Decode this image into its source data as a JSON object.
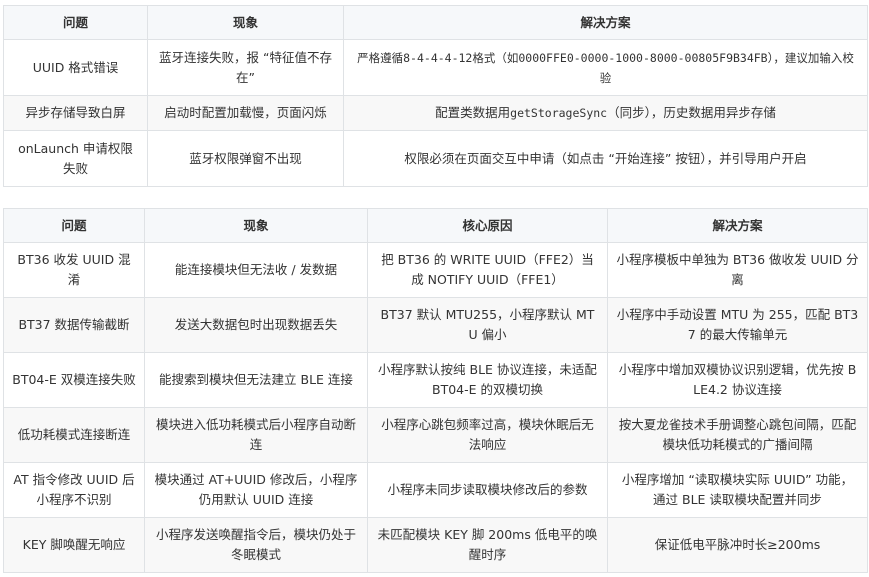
{
  "table1": {
    "headers": [
      "问题",
      "现象",
      "解决方案"
    ],
    "rows": [
      [
        "UUID 格式错误",
        "蓝牙连接失败，报 “特征值不存在”",
        "严格遵循8-4-4-4-12格式（如0000FFE0-0000-1000-8000-00805F9B34FB），建议加输入校验"
      ],
      [
        "异步存储导致白屏",
        "启动时配置加载慢，页面闪烁",
        "配置类数据用getStorageSync（同步），历史数据用异步存储"
      ],
      [
        "onLaunch 申请权限失败",
        "蓝牙权限弹窗不出现",
        "权限必须在页面交互中申请（如点击 “开始连接” 按钮），并引导用户开启"
      ]
    ]
  },
  "table2": {
    "headers": [
      "问题",
      "现象",
      "核心原因",
      "解决方案"
    ],
    "rows": [
      [
        "BT36 收发 UUID 混淆",
        "能连接模块但无法收 / 发数据",
        "把 BT36 的 WRITE UUID（FFE2）当成 NOTIFY UUID（FFE1）",
        "小程序模板中单独为 BT36 做收发 UUID 分离"
      ],
      [
        "BT37 数据传输截断",
        "发送大数据包时出现数据丢失",
        "BT37 默认 MTU255，小程序默认 MTU 偏小",
        "小程序中手动设置 MTU 为 255，匹配 BT37 的最大传输单元"
      ],
      [
        "BT04-E 双模连接失败",
        "能搜索到模块但无法建立 BLE 连接",
        "小程序默认按纯 BLE 协议连接，未适配 BT04-E 的双模切换",
        "小程序中增加双模协议识别逻辑，优先按 BLE4.2 协议连接"
      ],
      [
        "低功耗模式连接断连",
        "模块进入低功耗模式后小程序自动断连",
        "小程序心跳包频率过高，模块休眠后无法响应",
        "按大夏龙雀技术手册调整心跳包间隔，匹配模块低功耗模式的广播间隔"
      ],
      [
        "AT 指令修改 UUID 后小程序不识别",
        "模块通过 AT+UUID 修改后，小程序仍用默认 UUID 连接",
        "小程序未同步读取模块修改后的参数",
        "小程序增加 “读取模块实际 UUID” 功能，通过 BLE 读取模块配置并同步"
      ],
      [
        "KEY 脚唤醒无响应",
        "小程序发送唤醒指令后，模块仍处于冬眠模式",
        "未匹配模块 KEY 脚 200ms 低电平的唤醒时序",
        "保证低电平脉冲时长≥200ms"
      ]
    ]
  }
}
